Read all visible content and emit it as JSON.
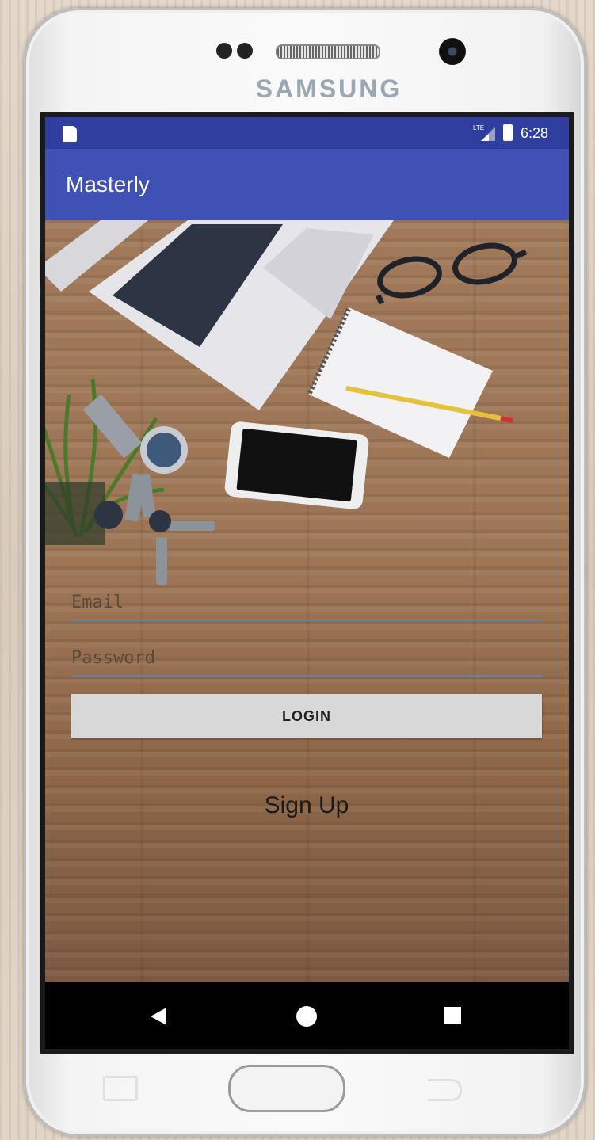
{
  "device": {
    "brand": "SAMSUNG"
  },
  "status_bar": {
    "time": "6:28"
  },
  "toolbar": {
    "title": "Masterly"
  },
  "login_form": {
    "email_placeholder": "Email",
    "password_placeholder": "Password",
    "login_label": "LOGIN",
    "signup_label": "Sign Up"
  },
  "colors": {
    "status_bar": "#303f9f",
    "toolbar": "#3f51b5",
    "button": "#d8d8d8",
    "nav_bar": "#000000"
  },
  "icons": {
    "status_left": "sd-card-icon",
    "status_right": [
      "signal-icon",
      "battery-icon"
    ],
    "nav": [
      "back-icon",
      "home-icon",
      "recents-icon"
    ]
  }
}
